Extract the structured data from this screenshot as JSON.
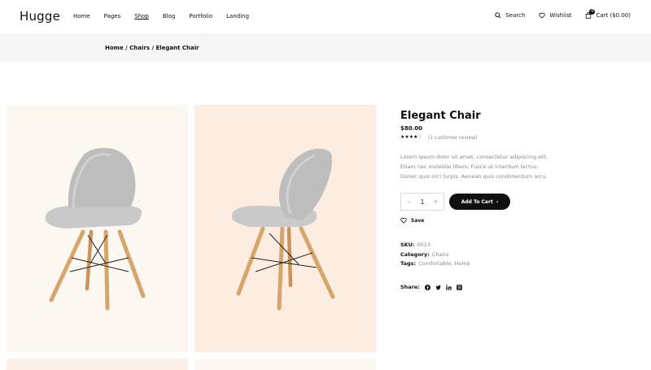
{
  "brand": {
    "logo": "Hugge"
  },
  "nav": {
    "items": [
      {
        "label": "Home",
        "active": false
      },
      {
        "label": "Pages",
        "active": false
      },
      {
        "label": "Shop",
        "active": true
      },
      {
        "label": "Blog",
        "active": false
      },
      {
        "label": "Portfolio",
        "active": false
      },
      {
        "label": "Landing",
        "active": false
      }
    ]
  },
  "header_actions": {
    "search_label": "Search",
    "wishlist_label": "Wishlist",
    "cart_label": "Cart ($0.00)",
    "cart_count": "0",
    "icons": {
      "search": "search-icon",
      "wishlist": "heart-icon",
      "cart": "bag-icon"
    }
  },
  "breadcrumb": {
    "items": [
      "Home",
      "Chairs",
      "Elegant Chair"
    ],
    "separator": " / "
  },
  "gallery": {
    "background_colors": [
      "#fdf7f2",
      "#fdece0",
      "#fdf0e6",
      "#fdf7f2"
    ]
  },
  "product": {
    "title": "Elegant Chair",
    "price": "$80.00",
    "rating": {
      "value": 4,
      "max": 5
    },
    "review_text": "(1 customer review)",
    "description": "Lorem ipsum dolor sit amet, consectetur adipiscing elit. Etiam nec molestie libero. Fusce ut interdum lectus. Donec quis orci turpis. Aenean quis condimentum arcu.",
    "quantity": "1",
    "qty_minus": "−",
    "qty_plus": "+",
    "add_to_cart_label": "Add To Cart",
    "add_to_cart_arrow": "›",
    "save_label": "Save",
    "sku_label": "SKU:",
    "sku_value": "0013",
    "category_label": "Category:",
    "category_value": "Chairs",
    "tags_label": "Tags:",
    "tags_value": "Comfortable, Home",
    "share_label": "Share:",
    "share_icons": [
      "facebook-icon",
      "twitter-icon",
      "linkedin-icon",
      "pinterest-icon"
    ]
  },
  "colors": {
    "accent": "#111111",
    "muted": "#888888",
    "breadcrumb_bg": "#f6f6f6"
  }
}
